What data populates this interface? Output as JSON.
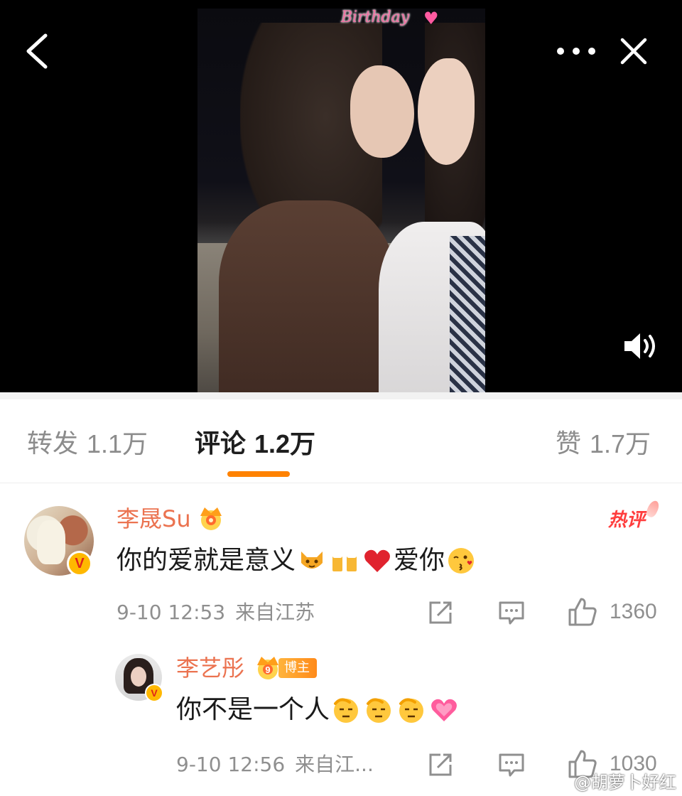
{
  "video": {
    "caption_text": "Birthday",
    "caption_icon": "heart-icon",
    "controls": {
      "back_icon": "back-chevron-icon",
      "more_icon": "more-dots-icon",
      "close_icon": "close-icon",
      "volume_icon": "volume-icon"
    }
  },
  "tabs": [
    {
      "label": "转发",
      "count": "1.1万",
      "active": false
    },
    {
      "label": "评论",
      "count": "1.2万",
      "active": true
    },
    {
      "label": "赞",
      "count": "1.7万",
      "active": false
    }
  ],
  "accent_color": "#ff8200",
  "username_color": "#eb7350",
  "comments": [
    {
      "username": "李晟Su",
      "verified": true,
      "badge_icon": "crown-icon",
      "hot_label": "热评",
      "text_before": "你的爱就是意义",
      "emojis_mid": [
        "fox-emoji",
        "cheers-emoji",
        "red-heart-emoji"
      ],
      "text_after": "爱你",
      "emojis_end": [
        "kiss-face-emoji"
      ],
      "time": "9-10 12:53",
      "location": "来自江苏",
      "likes": "1360"
    },
    {
      "username": "李艺彤",
      "verified": true,
      "badge_icon": "crown-level-icon",
      "badge_level": "9",
      "blogger_tag": "博主",
      "text_before": "你不是一个人",
      "emojis_end": [
        "salute-face-emoji",
        "salute-face-emoji",
        "salute-face-emoji",
        "pink-heart-emoji"
      ],
      "time": "9-10 12:56",
      "location": "来自江...",
      "likes": "1030"
    }
  ],
  "watermark": "@胡萝卜好红"
}
